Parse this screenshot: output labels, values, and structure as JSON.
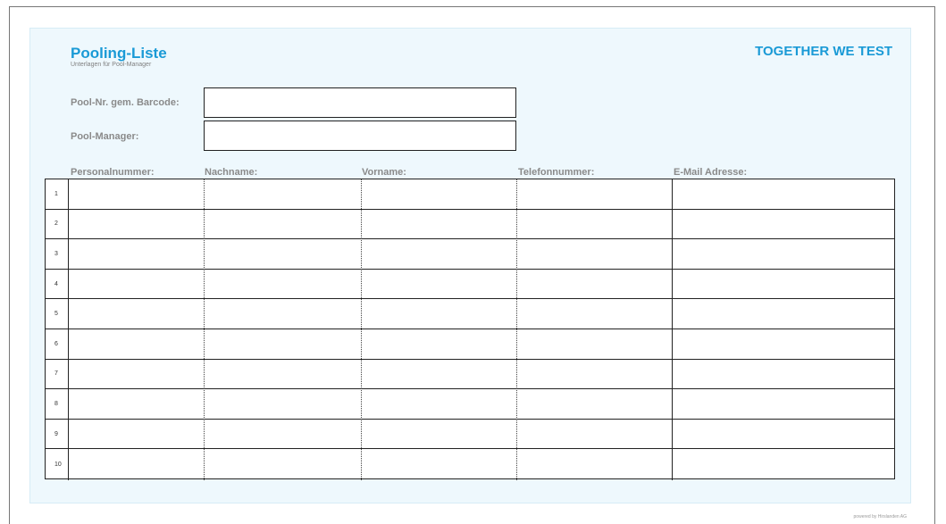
{
  "header": {
    "title": "Pooling-Liste",
    "subtitle": "Unterlagen für Pool-Manager",
    "tagline": "TOGETHER WE TEST"
  },
  "fields": {
    "barcode_label": "Pool-Nr. gem. Barcode:",
    "barcode_value": "",
    "manager_label": "Pool-Manager:",
    "manager_value": ""
  },
  "table": {
    "columns": [
      "Personalnummer:",
      "Nachname:",
      "Vorname:",
      "Telefonnummer:",
      "E-Mail Adresse:"
    ],
    "rows": [
      "1",
      "2",
      "3",
      "4",
      "5",
      "6",
      "7",
      "8",
      "9",
      "10"
    ]
  },
  "footer": {
    "text": "powered by Hirslanden AG"
  },
  "colors": {
    "accent": "#1a9ad6",
    "panel_background": "#eef8fd",
    "label_gray": "#8a8a8a"
  }
}
